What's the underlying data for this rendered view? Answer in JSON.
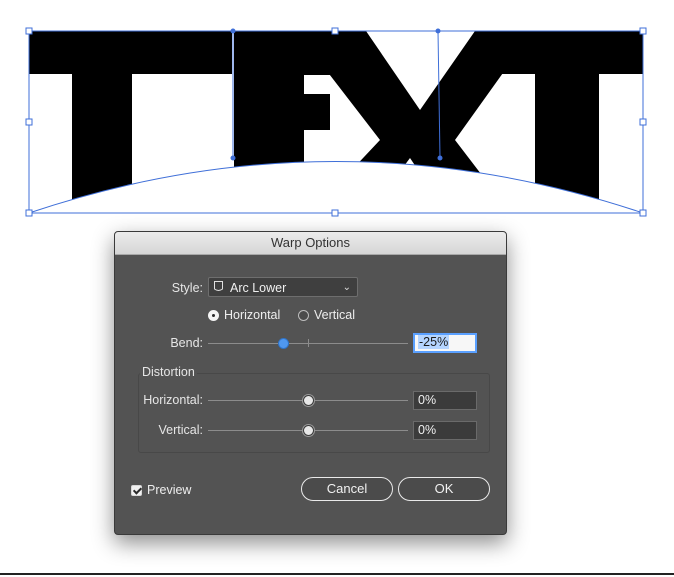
{
  "artwork": {
    "text": "TEXT"
  },
  "dialog": {
    "title": "Warp Options",
    "style": {
      "label": "Style:",
      "value": "Arc Lower",
      "icon": "arc-lower-warp-icon"
    },
    "orientation": {
      "horizontal_label": "Horizontal",
      "vertical_label": "Vertical",
      "selected": "Horizontal"
    },
    "bend": {
      "label": "Bend:",
      "value": "-25%",
      "fraction": -0.25
    },
    "distortion": {
      "title": "Distortion",
      "horizontal": {
        "label": "Horizontal:",
        "value": "0%",
        "fraction": 0
      },
      "vertical": {
        "label": "Vertical:",
        "value": "0%",
        "fraction": 0
      }
    },
    "preview": {
      "label": "Preview",
      "checked": true
    },
    "buttons": {
      "cancel": "Cancel",
      "ok": "OK"
    }
  },
  "colors": {
    "dialog_bg": "#535353",
    "selection_accent": "#4f98f0",
    "bounding_box": "#3f6fd8"
  }
}
